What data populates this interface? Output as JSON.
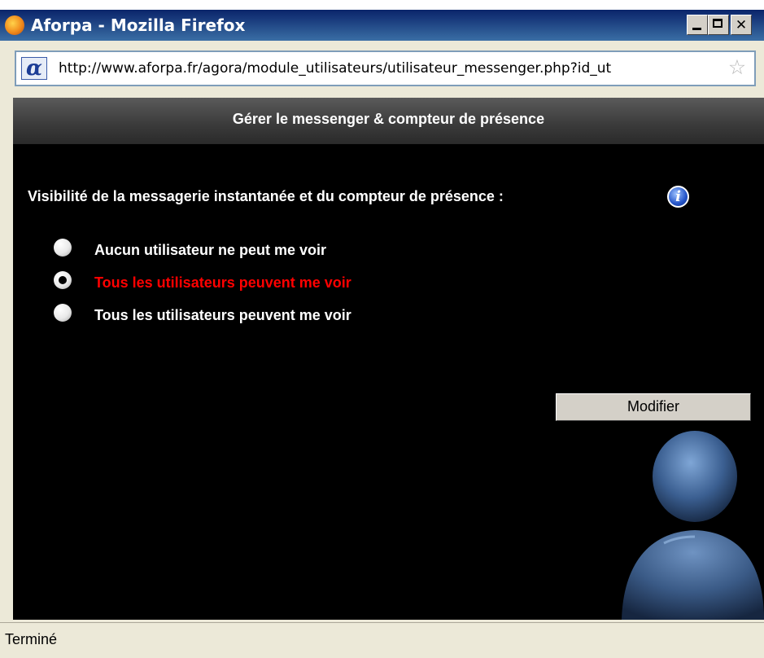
{
  "window": {
    "title": "Aforpa - Mozilla Firefox",
    "controls": {
      "minimize": "minimize",
      "maximize": "maximize",
      "close": "✕"
    }
  },
  "address_bar": {
    "site_icon": "α",
    "url": "http://www.aforpa.fr/agora/module_utilisateurs/utilisateur_messenger.php?id_ut"
  },
  "page": {
    "header": "Gérer le messenger & compteur de présence",
    "question": "Visibilité de la messagerie instantanée et du compteur de présence :",
    "info_icon": "i",
    "options": [
      {
        "label": "Aucun utilisateur ne peut me voir",
        "selected": false,
        "color": "#ffffff"
      },
      {
        "label": "Tous les utilisateurs peuvent me voir",
        "selected": true,
        "color": "#ff0000"
      },
      {
        "label": "Tous les utilisateurs peuvent me voir",
        "selected": false,
        "color": "#ffffff"
      }
    ],
    "submit_label": "Modifier"
  },
  "status_bar": {
    "text": "Terminé"
  },
  "colors": {
    "selected_option": "#ff0000",
    "page_background": "#000000",
    "titlebar": "#0a246a"
  }
}
